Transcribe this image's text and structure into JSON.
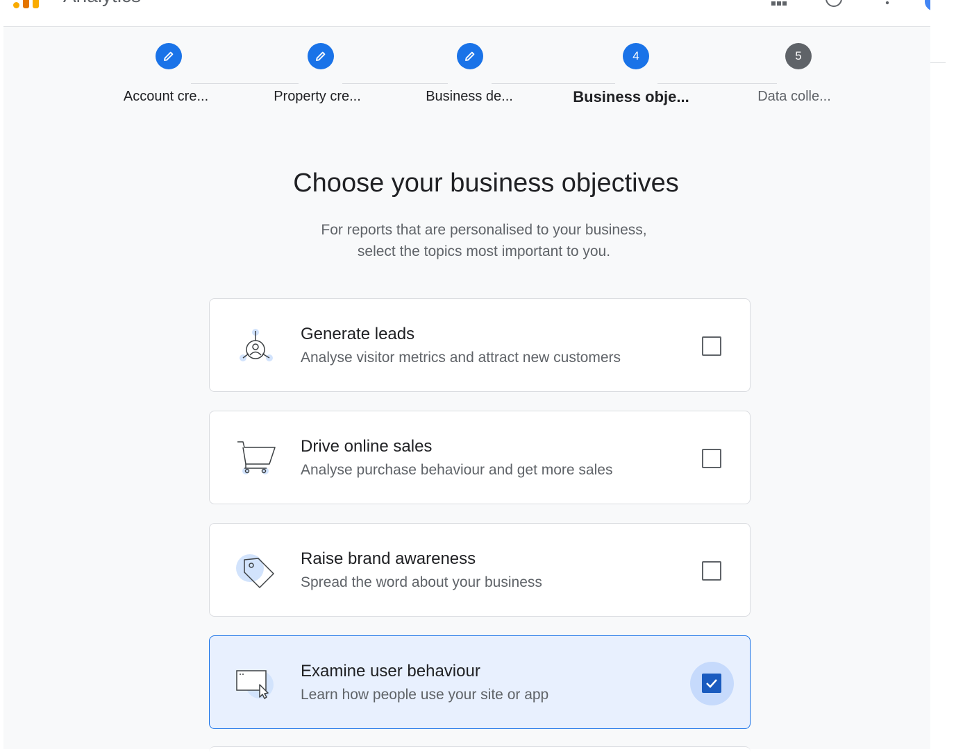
{
  "header": {
    "app_name": "Analytics"
  },
  "stepper": {
    "steps": [
      {
        "label": "Account cre...",
        "state": "done"
      },
      {
        "label": "Property cre...",
        "state": "done"
      },
      {
        "label": "Business de...",
        "state": "done"
      },
      {
        "label": "Business obje...",
        "state": "current",
        "number": "4"
      },
      {
        "label": "Data colle...",
        "state": "future",
        "number": "5"
      }
    ]
  },
  "page": {
    "title": "Choose your business objectives",
    "subtitle_line1": "For reports that are personalised to your business,",
    "subtitle_line2": "select the topics most important to you."
  },
  "objectives": [
    {
      "title": "Generate leads",
      "description": "Analyse visitor metrics and attract new customers",
      "icon": "leads-icon",
      "checked": false
    },
    {
      "title": "Drive online sales",
      "description": "Analyse purchase behaviour and get more sales",
      "icon": "shopping-cart-icon",
      "checked": false
    },
    {
      "title": "Raise brand awareness",
      "description": "Spread the word about your business",
      "icon": "tag-icon",
      "checked": false
    },
    {
      "title": "Examine user behaviour",
      "description": "Learn how people use your site or app",
      "icon": "browser-cursor-icon",
      "checked": true
    }
  ],
  "colors": {
    "accent": "#1a73e8",
    "selected_bg": "#e8f0fe",
    "page_bg": "#f8f9fa"
  }
}
